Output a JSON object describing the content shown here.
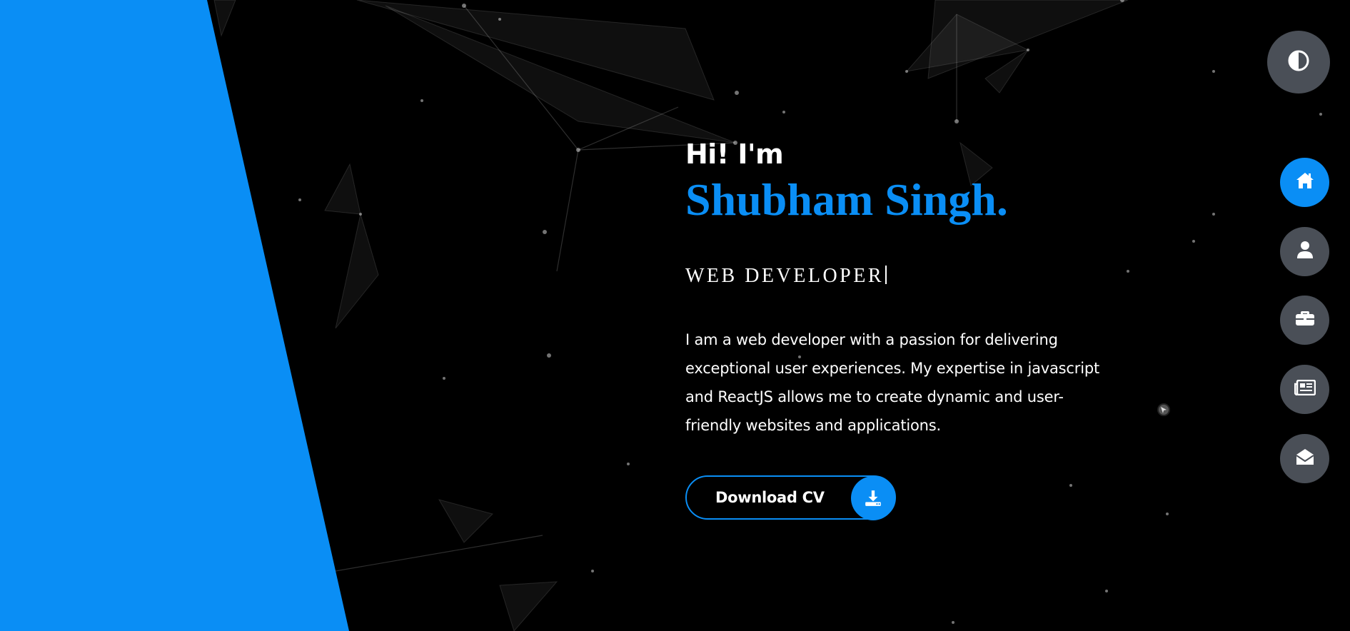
{
  "colors": {
    "accent": "#0a8ef5",
    "background": "#000000",
    "nav_inactive": "#4a4f57",
    "text": "#ffffff"
  },
  "hero": {
    "greeting": "Hi! I'm",
    "name": "Shubham Singh.",
    "role": "WEB DEVELOPER",
    "bio": "I am a web developer with a passion for delivering exceptional user experiences. My expertise in javascript and ReactJS allows me to create dynamic and user-friendly websites and applications."
  },
  "cv_button": {
    "label": "Download CV",
    "icon": "download-icon"
  },
  "theme_toggle": {
    "icon": "contrast-icon"
  },
  "nav": [
    {
      "icon": "home-icon",
      "active": true
    },
    {
      "icon": "user-icon",
      "active": false
    },
    {
      "icon": "briefcase-icon",
      "active": false
    },
    {
      "icon": "newspaper-icon",
      "active": false
    },
    {
      "icon": "envelope-open-icon",
      "active": false
    }
  ]
}
